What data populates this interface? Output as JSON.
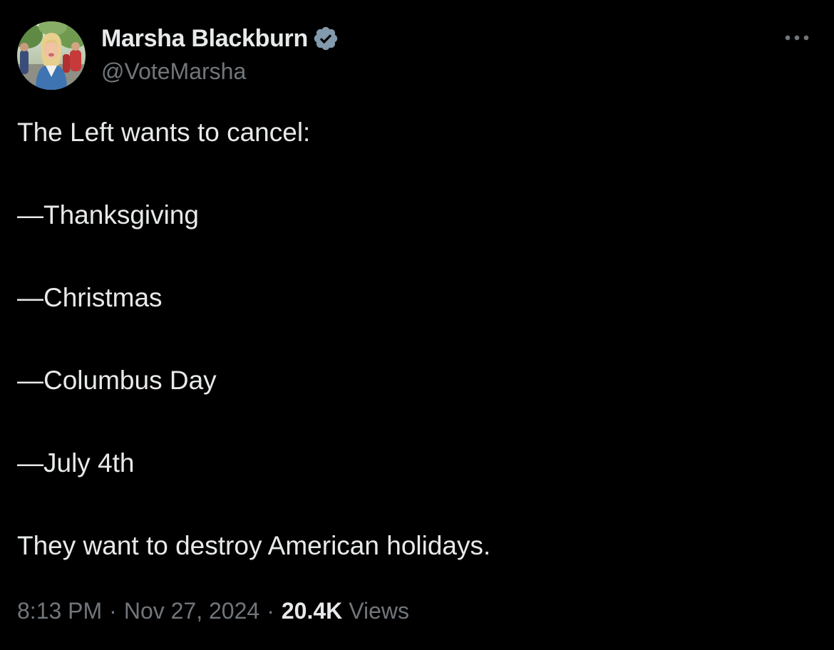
{
  "author": {
    "display_name": "Marsha Blackburn",
    "handle": "@VoteMarsha",
    "verified_icon": "verified-badge-icon",
    "avatar_icon": "avatar",
    "badge_color": "#829aab"
  },
  "menu": {
    "more_icon": "more-options-icon"
  },
  "tweet": {
    "lines": [
      "The Left wants to cancel:",
      "—Thanksgiving",
      "—Christmas",
      "—Columbus Day",
      "—July 4th",
      "They want to destroy American holidays."
    ]
  },
  "meta": {
    "time": "8:13 PM",
    "separator": "·",
    "date": "Nov 27, 2024",
    "views_count": "20.4K",
    "views_label": "Views"
  },
  "colors": {
    "background": "#000000",
    "primary_text": "#e7e9ea",
    "secondary_text": "#71767b"
  }
}
